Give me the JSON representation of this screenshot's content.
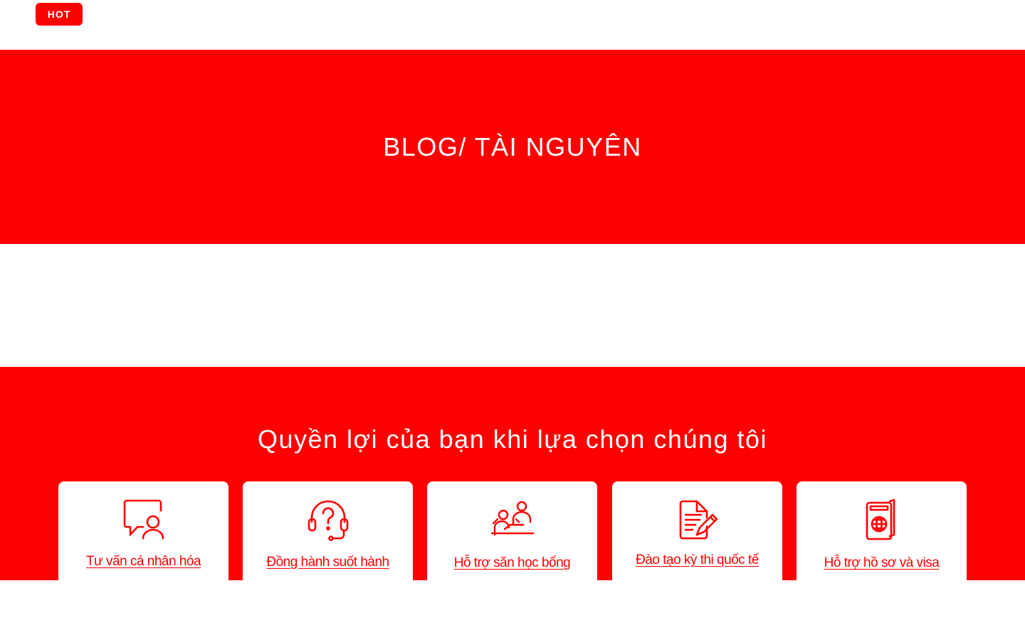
{
  "colors": {
    "brand_red": "#ff0000",
    "white": "#ffffff"
  },
  "header": {
    "hot_badge": "HOT"
  },
  "hero": {
    "title": "BLOG/ TÀI NGUYÊN"
  },
  "benefits": {
    "title": "Quyền lợi của bạn khi lựa chọn chúng tôi",
    "cards": [
      {
        "icon": "consulting-chat-person-icon",
        "label": "Tư vấn cá nhân hóa"
      },
      {
        "icon": "headset-question-icon",
        "label": "Đồng hành suốt hành"
      },
      {
        "icon": "scholarship-study-icon",
        "label": "Hỗ trợ săn học bổng"
      },
      {
        "icon": "exam-document-pen-icon",
        "label": "Đào tạo kỳ thi quốc tế"
      },
      {
        "icon": "passport-visa-icon",
        "label": "Hỗ trợ hồ sơ và visa"
      }
    ]
  }
}
